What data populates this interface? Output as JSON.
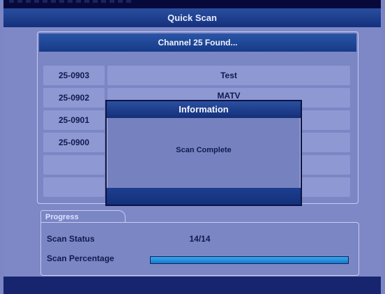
{
  "window": {
    "title": "Quick Scan"
  },
  "channel_list": {
    "header": "Channel 25 Found...",
    "rows": [
      {
        "id": "25-0903",
        "name": "Test"
      },
      {
        "id": "25-0902",
        "name": "MATV"
      },
      {
        "id": "25-0901",
        "name": ""
      },
      {
        "id": "25-0900",
        "name": ""
      },
      {
        "id": "",
        "name": ""
      },
      {
        "id": "",
        "name": ""
      }
    ]
  },
  "dialog": {
    "title": "Information",
    "message": "Scan Complete"
  },
  "progress": {
    "tab_label": "Progress",
    "status_label": "Scan Status",
    "status_value": "14/14",
    "percentage_label": "Scan Percentage",
    "percentage_fraction": 1.0
  },
  "colors": {
    "background": "#7e88c6",
    "bar_blue": "#1d3e90",
    "progress_fill": "#2a92dc"
  }
}
